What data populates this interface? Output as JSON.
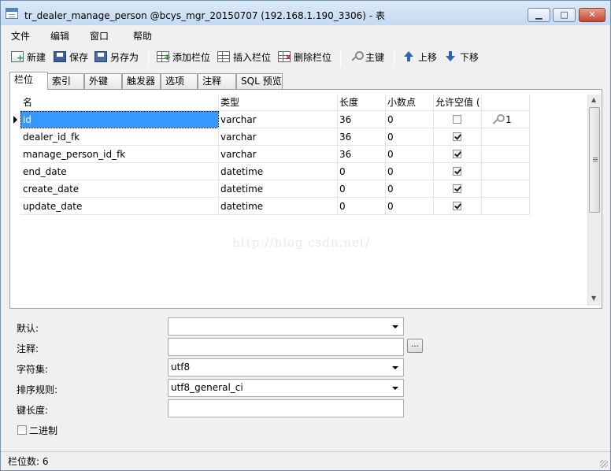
{
  "window": {
    "title": "tr_dealer_manage_person @bcys_mgr_20150707 (192.168.1.190_3306) - 表",
    "controls": {
      "minimize": "▁",
      "maximize": "□",
      "close": "✕"
    }
  },
  "menu": [
    "文件",
    "编辑",
    "窗口",
    "帮助"
  ],
  "toolbar": {
    "new": "新建",
    "save": "保存",
    "save_as": "另存为",
    "add_column": "添加栏位",
    "insert_column": "插入栏位",
    "delete_column": "删除栏位",
    "primary_key": "主键",
    "move_up": "上移",
    "move_down": "下移"
  },
  "tabs": [
    "栏位",
    "索引",
    "外键",
    "触发器",
    "选项",
    "注释",
    "SQL 预览"
  ],
  "grid": {
    "headers": [
      "名",
      "类型",
      "长度",
      "小数点",
      "允许空值 ("
    ],
    "rows": [
      {
        "name": "id",
        "type": "varchar",
        "length": "36",
        "decimals": "0",
        "nullable": false,
        "pk": "1"
      },
      {
        "name": "dealer_id_fk",
        "type": "varchar",
        "length": "36",
        "decimals": "0",
        "nullable": true,
        "pk": ""
      },
      {
        "name": "manage_person_id_fk",
        "type": "varchar",
        "length": "36",
        "decimals": "0",
        "nullable": true,
        "pk": ""
      },
      {
        "name": "end_date",
        "type": "datetime",
        "length": "0",
        "decimals": "0",
        "nullable": true,
        "pk": ""
      },
      {
        "name": "create_date",
        "type": "datetime",
        "length": "0",
        "decimals": "0",
        "nullable": true,
        "pk": ""
      },
      {
        "name": "update_date",
        "type": "datetime",
        "length": "0",
        "decimals": "0",
        "nullable": true,
        "pk": ""
      }
    ],
    "watermark": "http://blog.csdn.net/"
  },
  "props": {
    "default_label": "默认:",
    "default_value": "",
    "comment_label": "注释:",
    "comment_value": "",
    "ellipsis": "...",
    "charset_label": "字符集:",
    "charset_value": "utf8",
    "collation_label": "排序规则:",
    "collation_value": "utf8_general_ci",
    "key_length_label": "键长度:",
    "key_length_value": "",
    "binary_label": "二进制"
  },
  "status": {
    "text": "栏位数: 6"
  },
  "colors": {
    "selection": "#3399ff",
    "title_bar": "#c4daf1"
  }
}
